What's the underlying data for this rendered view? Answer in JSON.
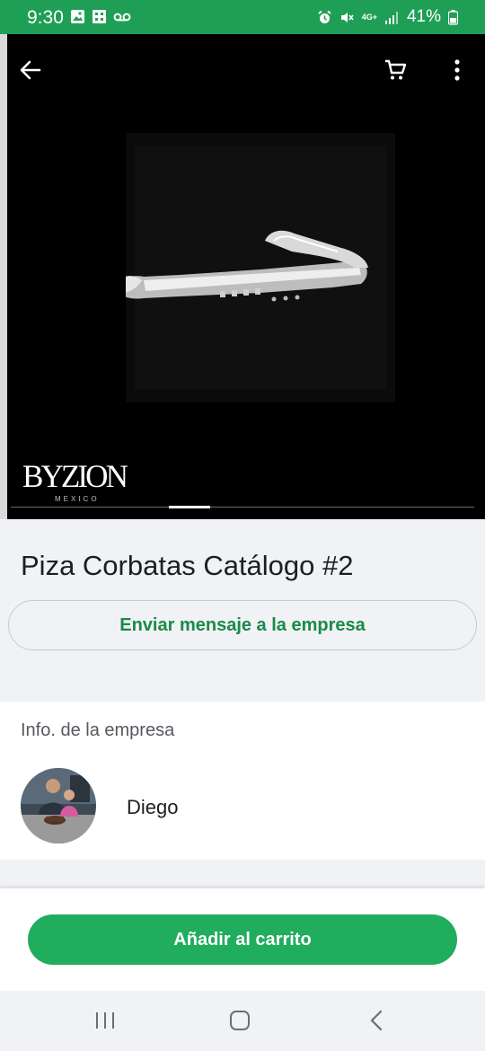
{
  "status_bar": {
    "time": "9:30",
    "battery": "41%",
    "network": "4G+",
    "icons": [
      "gallery-icon",
      "app-icon",
      "voicemail-icon",
      "alarm-icon",
      "mute-icon",
      "network-4g-icon",
      "signal-icon",
      "battery-icon"
    ],
    "color": "#1f9f56"
  },
  "product": {
    "title": "Piza Corbatas Catálogo #2",
    "brand_logo": "BYZION",
    "brand_sub": "MEXICO",
    "image_count": 1
  },
  "actions": {
    "message_label": "Enviar mensaje a la empresa",
    "add_to_cart_label": "Añadir al carrito"
  },
  "business": {
    "heading": "Info. de la empresa",
    "name": "Diego"
  },
  "colors": {
    "accent": "#20ad5d",
    "accent_text": "#1a8a47",
    "background": "#f0f2f5"
  }
}
